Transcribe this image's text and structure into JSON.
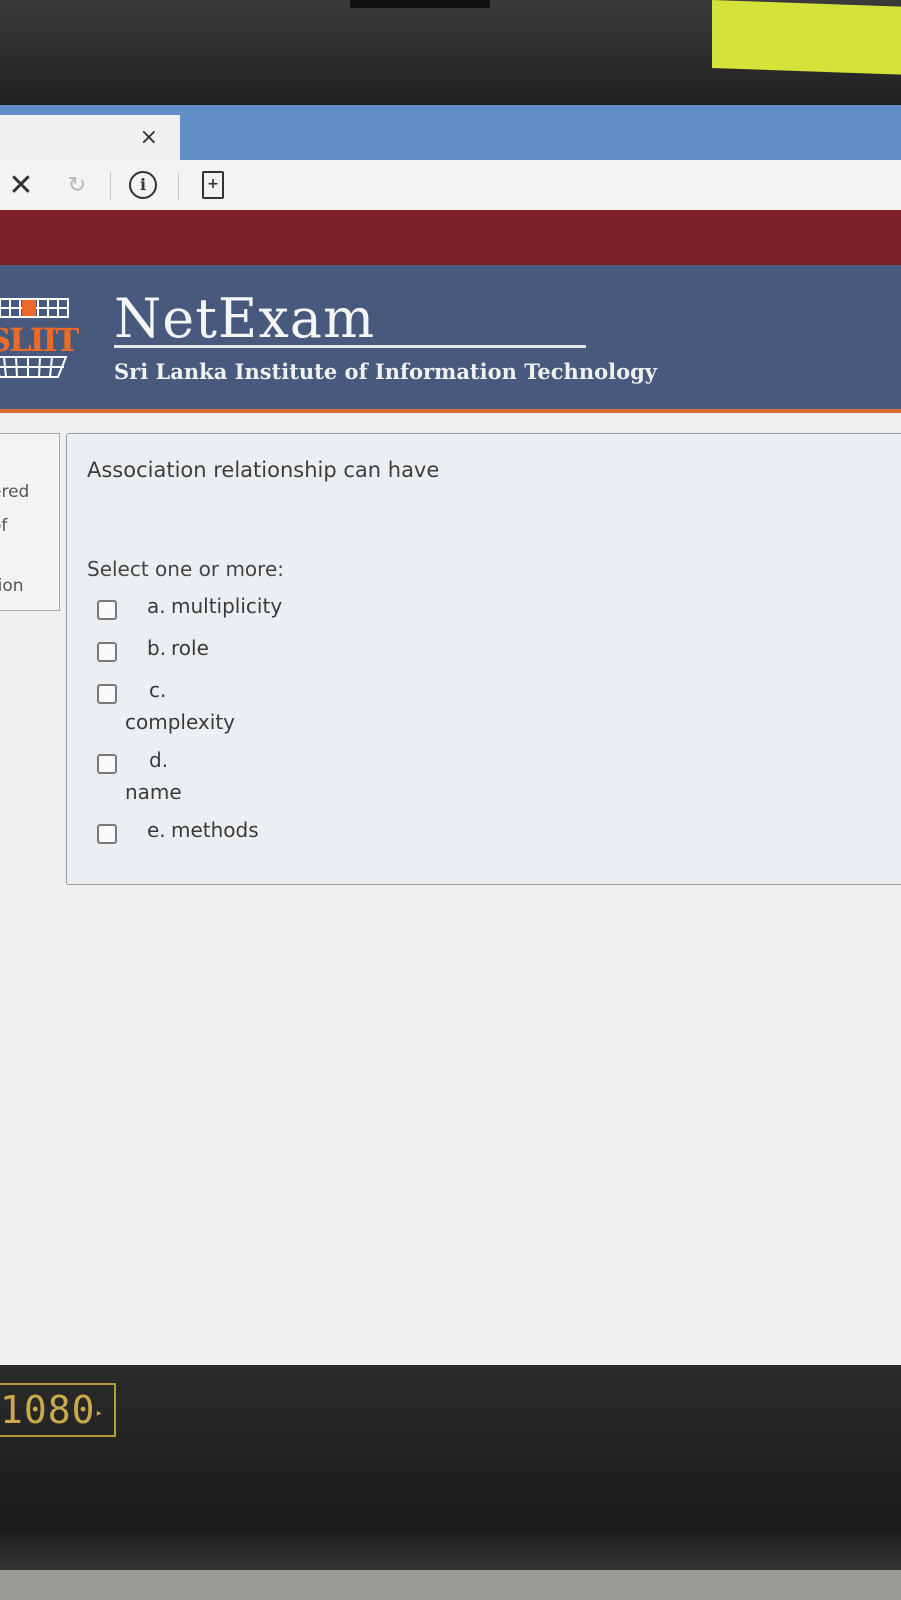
{
  "browser": {
    "tab_close_glyph": "×",
    "stop_glyph": "✕",
    "reload_glyph": "↻"
  },
  "site": {
    "logo_text": "SLIIT",
    "title": "NetExam",
    "subtitle": "Sri Lanka Institute of Information Technology",
    "colors": {
      "header_bg": "#475a7e",
      "top_band": "#7d1f27",
      "accent": "#d9703a"
    }
  },
  "sidebar_info": {
    "lines": [
      "ered",
      "of",
      "tion"
    ]
  },
  "question": {
    "text": "Association relationship can have",
    "prompt": "Select one or more:",
    "options": [
      {
        "letter": "a.",
        "text": "multiplicity",
        "checked": false
      },
      {
        "letter": "b.",
        "text": "role",
        "checked": false
      },
      {
        "letter": "c.",
        "text": "complexity",
        "checked": false
      },
      {
        "letter": "d.",
        "text": "name",
        "checked": false
      },
      {
        "letter": "e.",
        "text": "methods",
        "checked": false
      }
    ]
  },
  "monitor": {
    "resolution_badge": "1080"
  }
}
